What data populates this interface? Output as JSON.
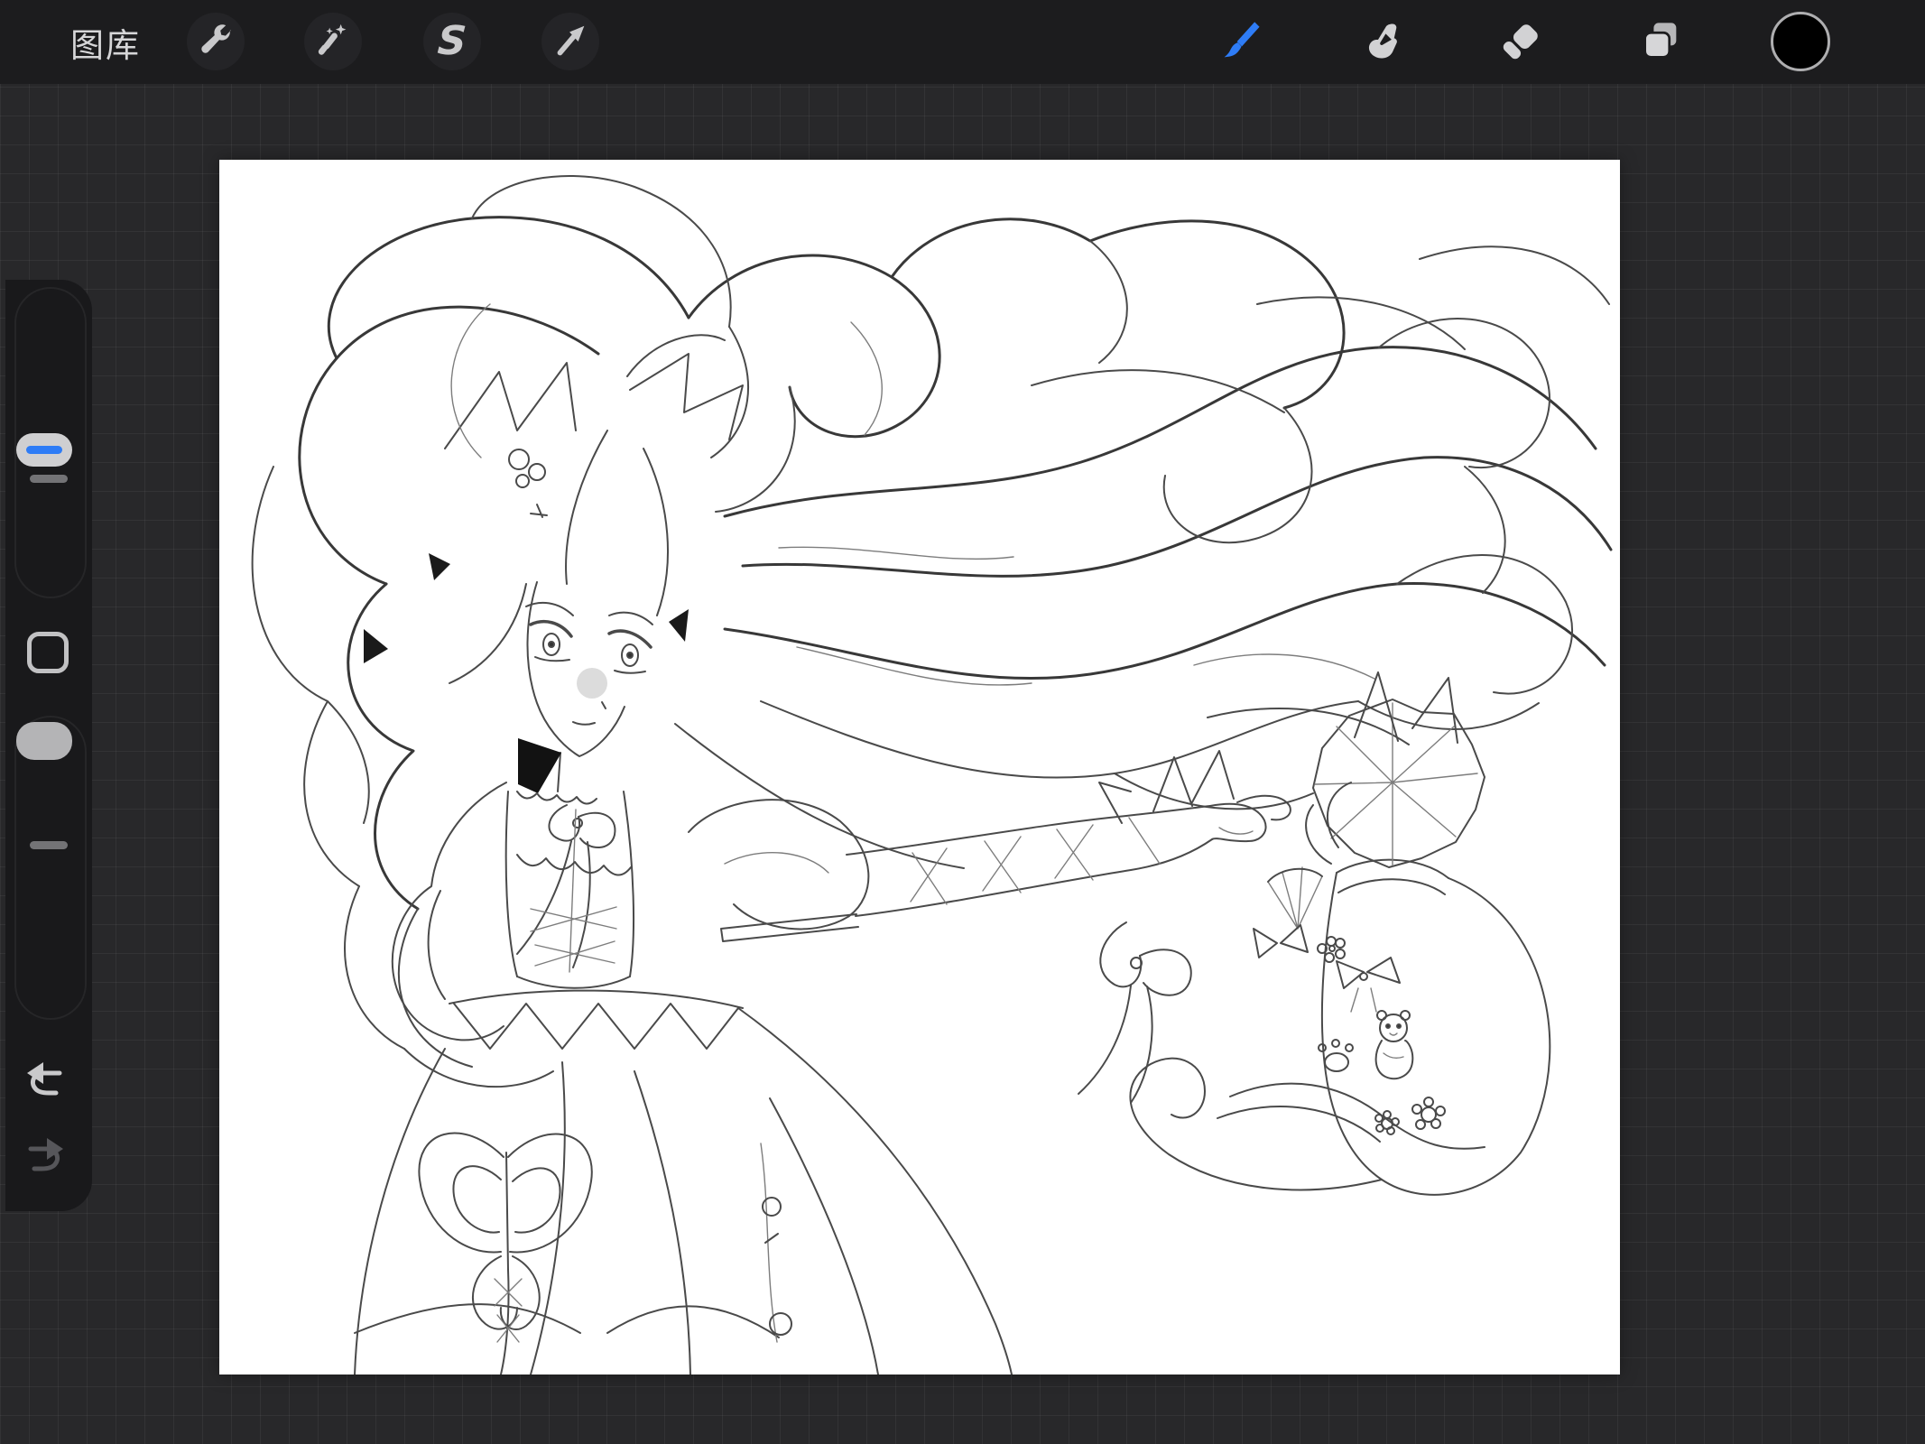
{
  "toolbar": {
    "gallery_label": "图库",
    "selection_glyph": "S",
    "left_tools": [
      {
        "id": "actions",
        "icon": "wrench-icon"
      },
      {
        "id": "adjustments",
        "icon": "magic-wand-icon"
      },
      {
        "id": "selection",
        "icon": "selection-s-icon"
      },
      {
        "id": "transform",
        "icon": "transform-arrow-icon"
      }
    ],
    "right_tools": [
      {
        "id": "paint",
        "icon": "paint-brush-icon",
        "active": true
      },
      {
        "id": "smudge",
        "icon": "smudge-finger-icon",
        "active": false
      },
      {
        "id": "erase",
        "icon": "eraser-icon",
        "active": false
      },
      {
        "id": "layers",
        "icon": "layers-icon",
        "active": false
      },
      {
        "id": "color",
        "icon": "color-swatch",
        "active": false
      }
    ],
    "active_tool": "paint",
    "accent_color": "#2E7CF6",
    "current_color": "#000000"
  },
  "sidebar": {
    "controls": [
      "brush-size-slider",
      "modify-button",
      "opacity-slider",
      "undo-button",
      "redo-button"
    ],
    "brush_size_indicator_color": "#2E7CF6"
  },
  "canvas": {
    "background": "#FFFFFF",
    "content": "monochrome line-art sketch: girl with long flowing wavy hair, frilled dress with ribbon lacing, extended arm pointing at a decorated cat-shaped pouch with pleated fan flower, bows, teddy bear, paw print and flowers"
  },
  "colors": {
    "app_background": "#28282A",
    "toolbar_background": "#1C1C1E",
    "sidebar_background": "#19191B",
    "icon_gray": "#C9C9CB"
  }
}
